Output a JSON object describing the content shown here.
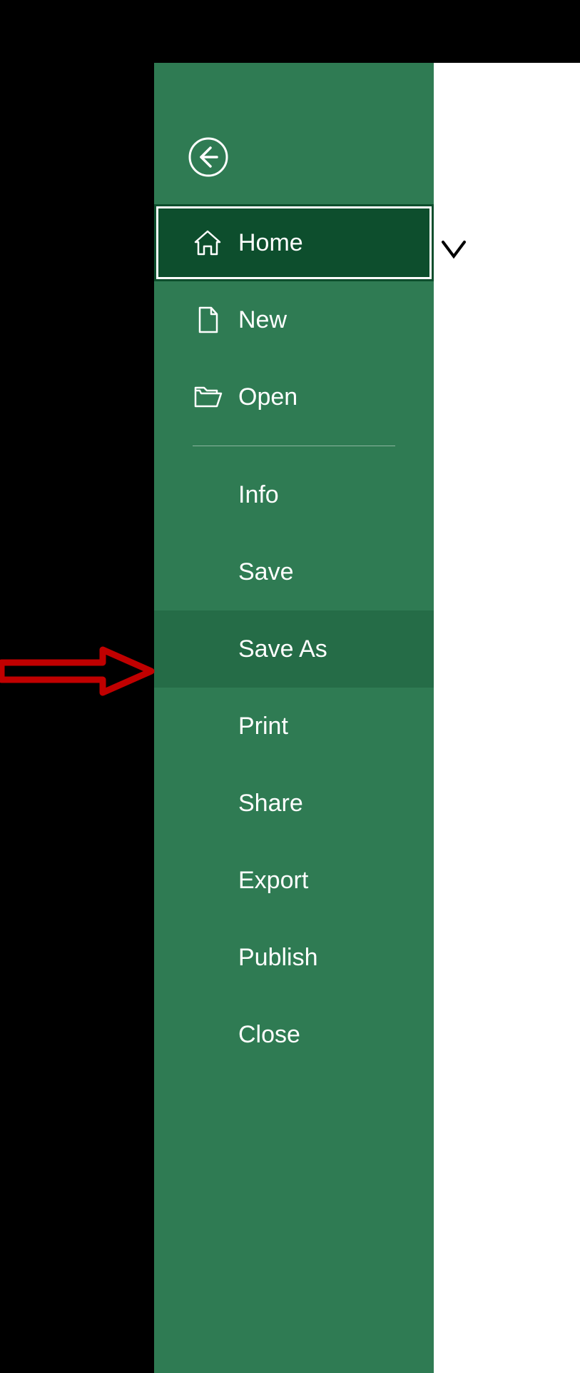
{
  "sidebar": {
    "items": [
      {
        "label": "Home",
        "icon": "home-icon",
        "selected": true,
        "hover": false
      },
      {
        "label": "New",
        "icon": "new-file-icon",
        "selected": false,
        "hover": false
      },
      {
        "label": "Open",
        "icon": "folder-open-icon",
        "selected": false,
        "hover": false
      },
      {
        "label": "Info",
        "icon": null,
        "selected": false,
        "hover": false
      },
      {
        "label": "Save",
        "icon": null,
        "selected": false,
        "hover": false
      },
      {
        "label": "Save As",
        "icon": null,
        "selected": false,
        "hover": true
      },
      {
        "label": "Print",
        "icon": null,
        "selected": false,
        "hover": false
      },
      {
        "label": "Share",
        "icon": null,
        "selected": false,
        "hover": false
      },
      {
        "label": "Export",
        "icon": null,
        "selected": false,
        "hover": false
      },
      {
        "label": "Publish",
        "icon": null,
        "selected": false,
        "hover": false
      },
      {
        "label": "Close",
        "icon": null,
        "selected": false,
        "hover": false
      }
    ]
  },
  "colors": {
    "sidebar_bg": "#2f7b53",
    "selected_bg": "#0d4e2d",
    "hover_bg": "#256c47",
    "arrow": "#c00000"
  }
}
